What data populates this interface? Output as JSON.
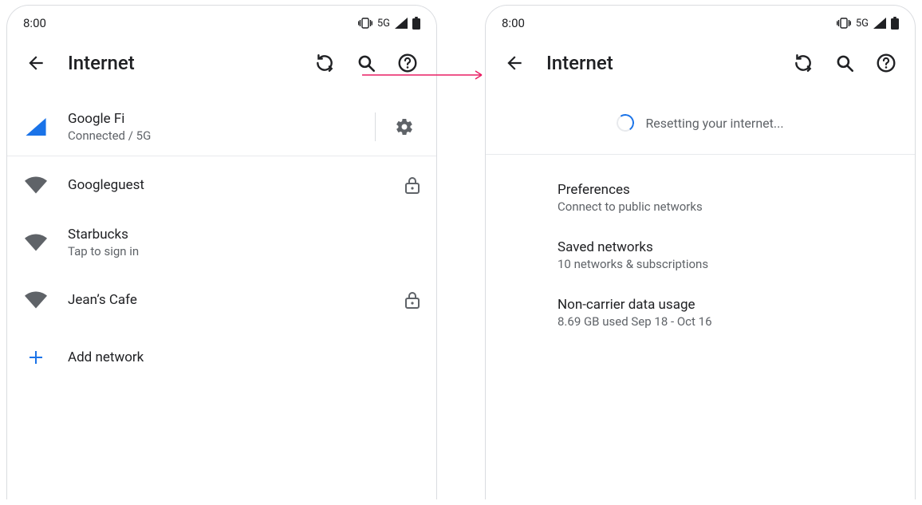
{
  "status": {
    "time": "8:00",
    "network_label": "5G"
  },
  "appbar": {
    "title": "Internet"
  },
  "left": {
    "carrier": {
      "name": "Google Fi",
      "status": "Connected / 5G"
    },
    "networks": [
      {
        "ssid": "Googleguest",
        "secondary": null,
        "locked": true
      },
      {
        "ssid": "Starbucks",
        "secondary": "Tap to sign in",
        "locked": false
      },
      {
        "ssid": "Jean’s Cafe",
        "secondary": null,
        "locked": true
      }
    ],
    "add_network_label": "Add network"
  },
  "right": {
    "resetting_label": "Resetting your internet...",
    "items": [
      {
        "title": "Preferences",
        "subtitle": "Connect to public networks"
      },
      {
        "title": "Saved networks",
        "subtitle": "10 networks & subscriptions"
      },
      {
        "title": "Non-carrier data usage",
        "subtitle": "8.69 GB used Sep 18 - Oct 16"
      }
    ]
  }
}
